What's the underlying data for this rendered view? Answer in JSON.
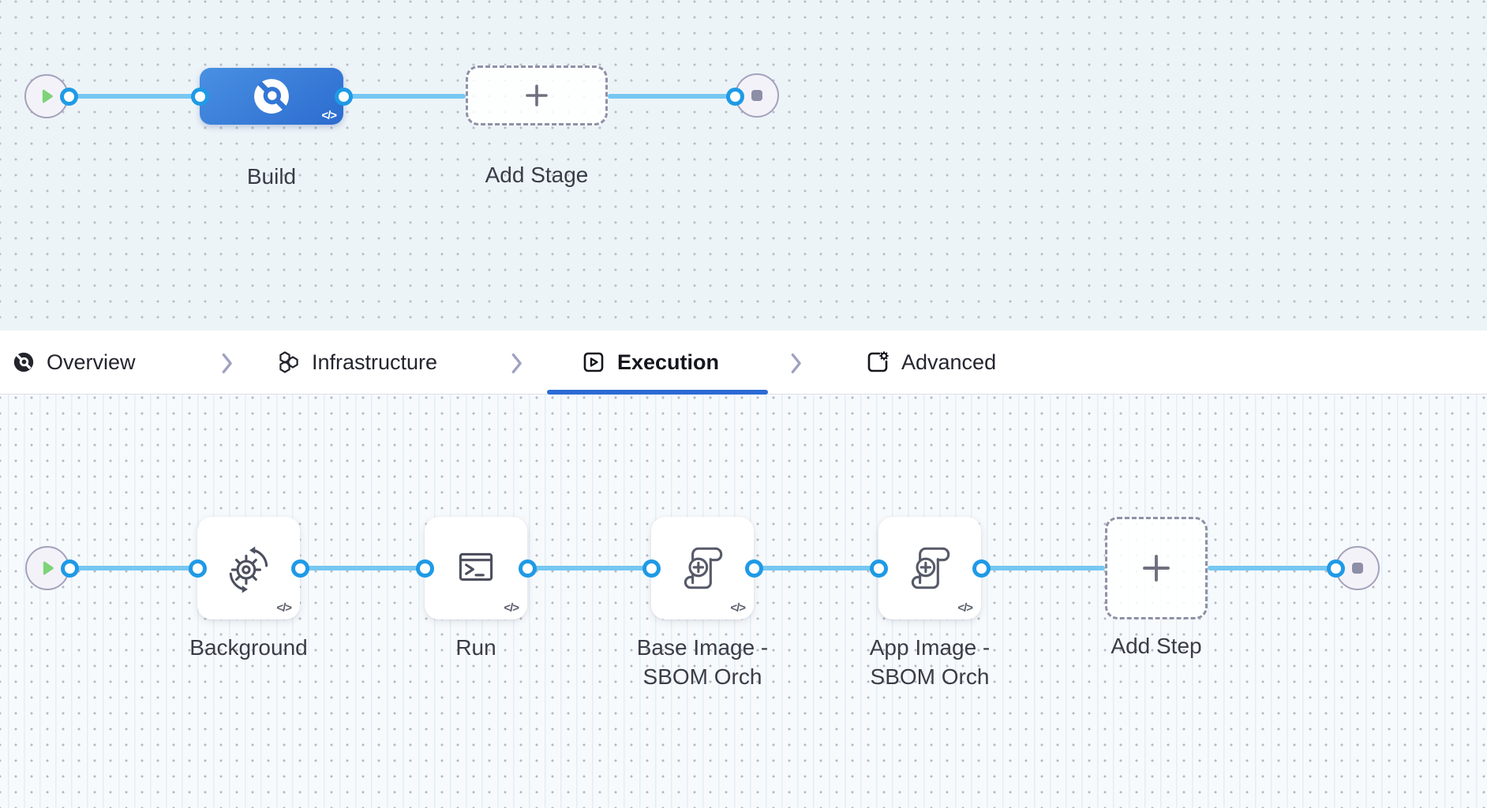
{
  "tab_bar": {
    "tabs": [
      {
        "label": "Overview",
        "icon": "ci-overview-icon",
        "active": false
      },
      {
        "label": "Infrastructure",
        "icon": "hexagons-icon",
        "active": false
      },
      {
        "label": "Execution",
        "icon": "play-square-icon",
        "active": true
      },
      {
        "label": "Advanced",
        "icon": "settings-box-icon",
        "active": false
      }
    ],
    "active_tab": "Execution"
  },
  "stage_pipeline": {
    "stage_label": "Build",
    "add_stage_label": "Add Stage"
  },
  "execution_pipeline": {
    "steps": [
      {
        "label": "Background",
        "icon": "gear-sync-icon"
      },
      {
        "label": "Run",
        "icon": "terminal-icon"
      },
      {
        "label": "Base Image - SBOM Orch",
        "icon": "scroll-plus-icon"
      },
      {
        "label": "App Image - SBOM Orch",
        "icon": "scroll-plus-icon"
      }
    ],
    "add_step_label": "Add Step"
  },
  "glyphs": {
    "code": "</>"
  },
  "colors": {
    "stage_blue_start": "#4990e2",
    "stage_blue_end": "#2c6ccf",
    "edge_blue": "#76c7f2",
    "port_blue": "#1f9ae6",
    "play_green": "#7ed379",
    "stop_gray": "#8d8fa6",
    "tab_underline_blue": "#2b6bd4",
    "canvas_top_bg": "#edf4f8",
    "canvas_bottom_bg": "#f7fafc"
  }
}
